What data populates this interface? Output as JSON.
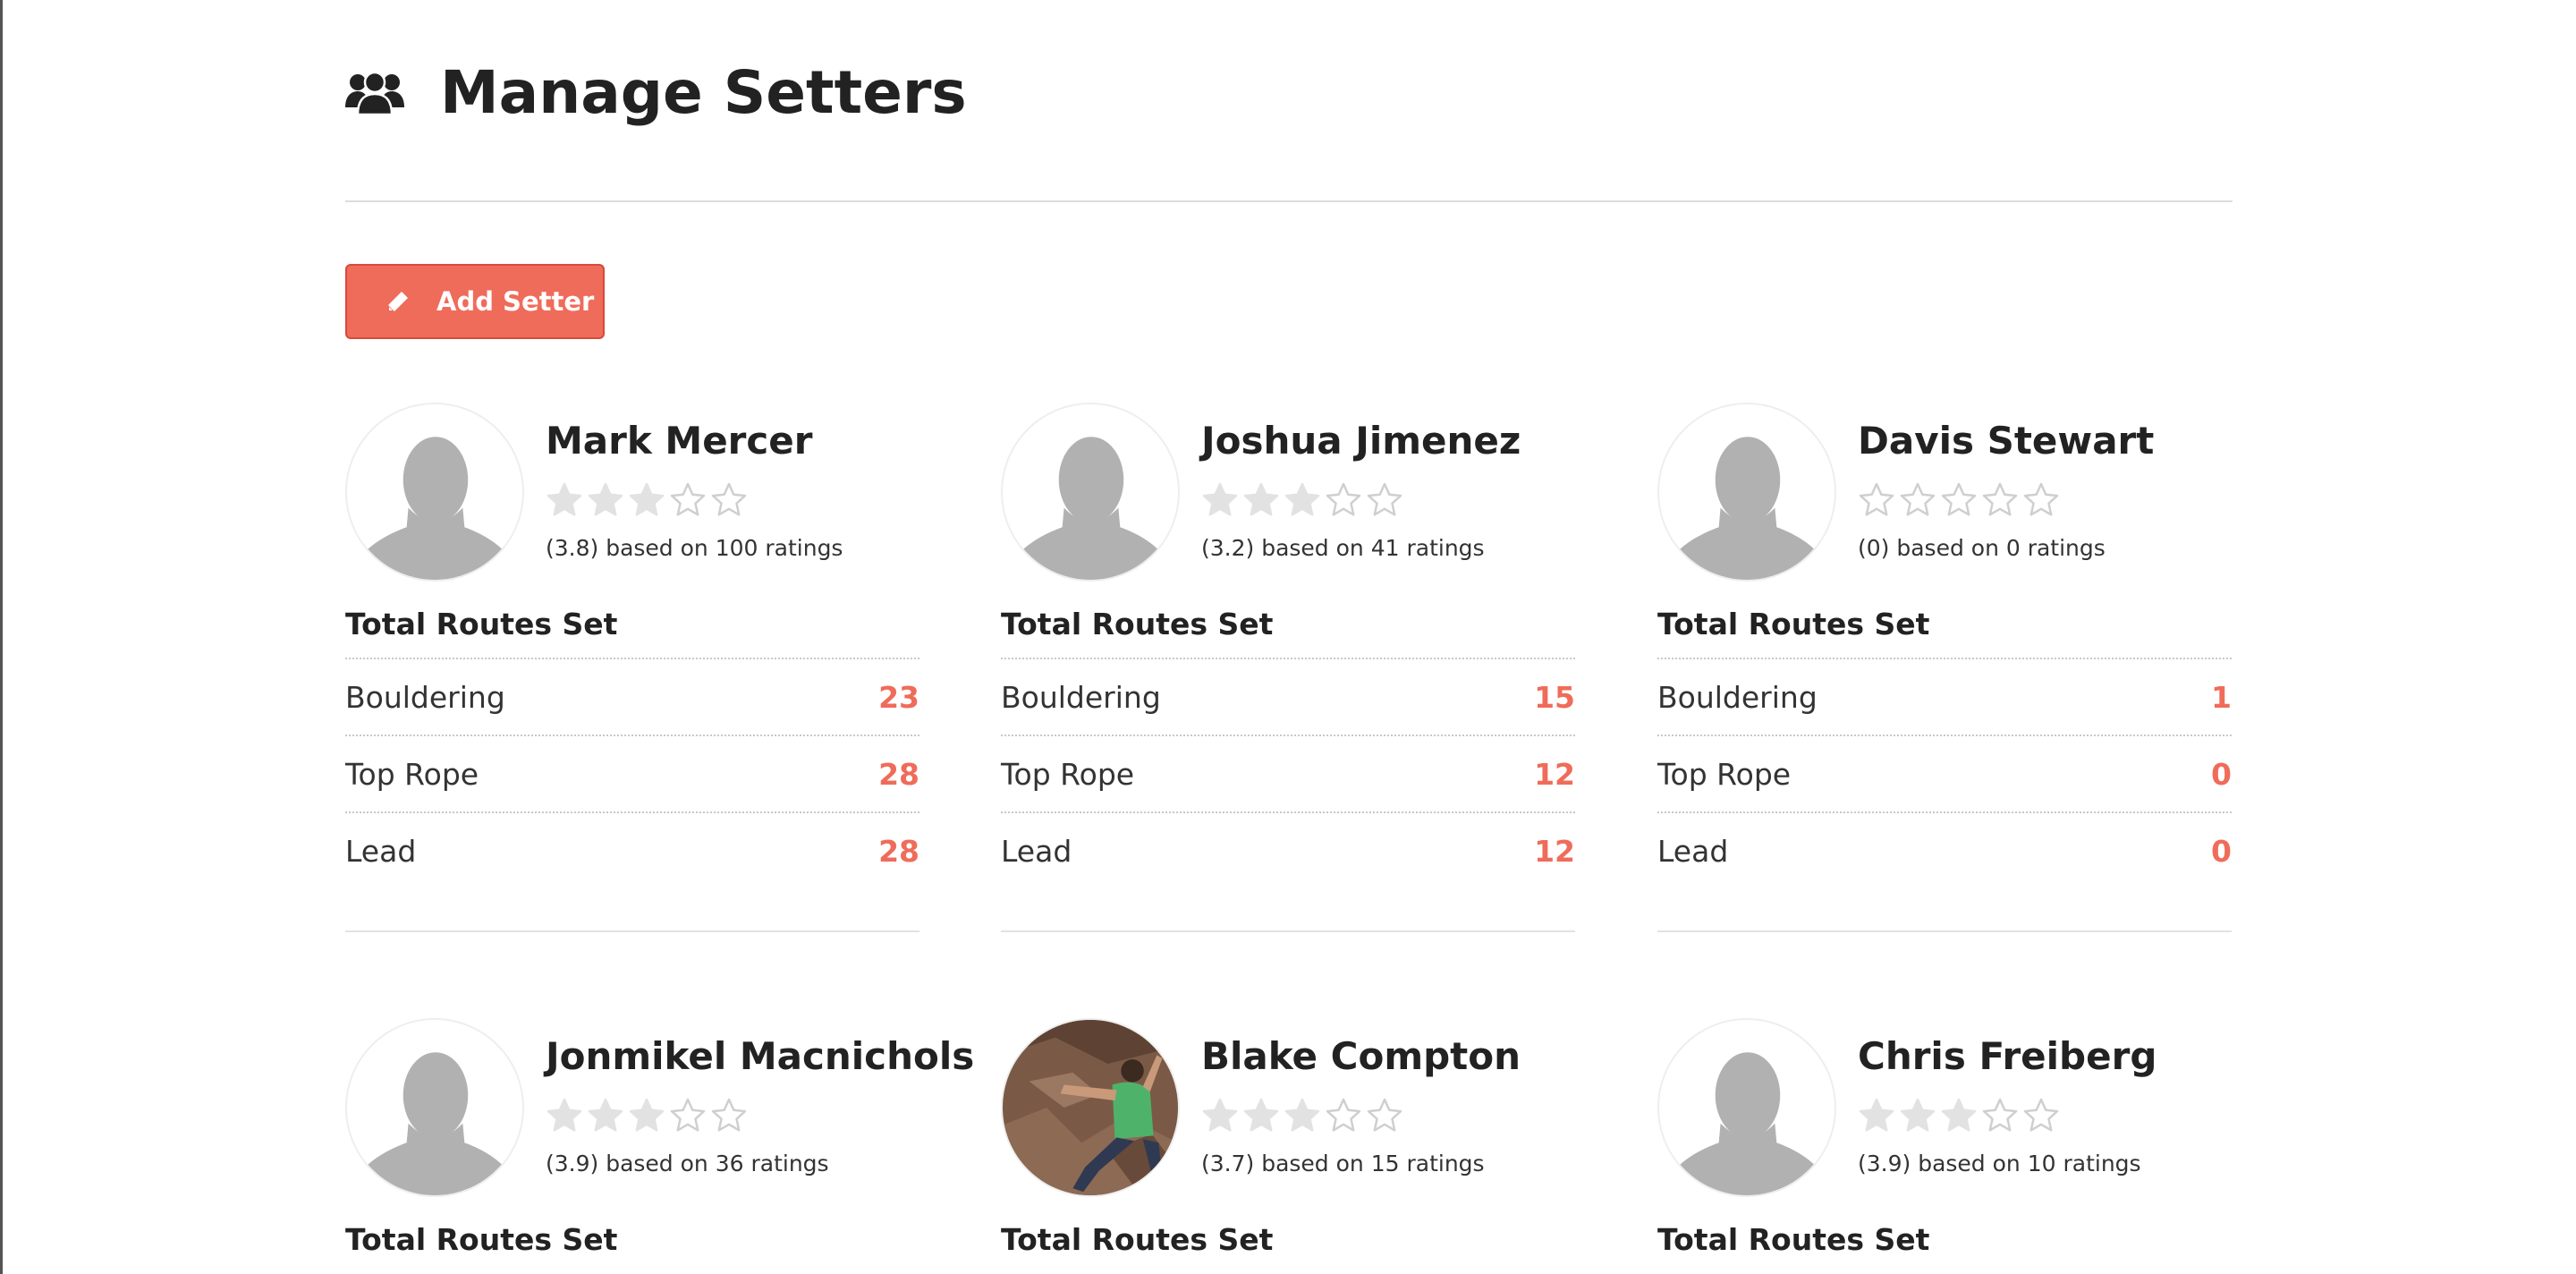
{
  "header": {
    "title": "Manage Setters",
    "icon": "users-icon"
  },
  "add_button": {
    "label": "Add Setter",
    "icon": "pencil-icon"
  },
  "colors": {
    "accent": "#ef6c5a",
    "star_filled": "#e2e2e2",
    "star_empty": "#cfcfcf"
  },
  "section_label": "Total Routes Set",
  "setters": [
    {
      "name": "Mark Mercer",
      "rating": 3,
      "rating_text": "(3.8) based on 100 ratings",
      "photo": false,
      "routes": [
        {
          "label": "Bouldering",
          "value": "23"
        },
        {
          "label": "Top Rope",
          "value": "28"
        },
        {
          "label": "Lead",
          "value": "28"
        }
      ]
    },
    {
      "name": "Joshua Jimenez",
      "rating": 3,
      "rating_text": "(3.2) based on 41 ratings",
      "photo": false,
      "routes": [
        {
          "label": "Bouldering",
          "value": "15"
        },
        {
          "label": "Top Rope",
          "value": "12"
        },
        {
          "label": "Lead",
          "value": "12"
        }
      ]
    },
    {
      "name": "Davis Stewart",
      "rating": 0,
      "rating_text": "(0) based on 0 ratings",
      "photo": false,
      "routes": [
        {
          "label": "Bouldering",
          "value": "1"
        },
        {
          "label": "Top Rope",
          "value": "0"
        },
        {
          "label": "Lead",
          "value": "0"
        }
      ]
    },
    {
      "name": "Jonmikel Macnichols",
      "rating": 3,
      "rating_text": "(3.9) based on 36 ratings",
      "photo": false,
      "routes": []
    },
    {
      "name": "Blake Compton",
      "rating": 3,
      "rating_text": "(3.7) based on 15 ratings",
      "photo": true,
      "routes": []
    },
    {
      "name": "Chris Freiberg",
      "rating": 3,
      "rating_text": "(3.9) based on 10 ratings",
      "photo": false,
      "routes": []
    }
  ]
}
